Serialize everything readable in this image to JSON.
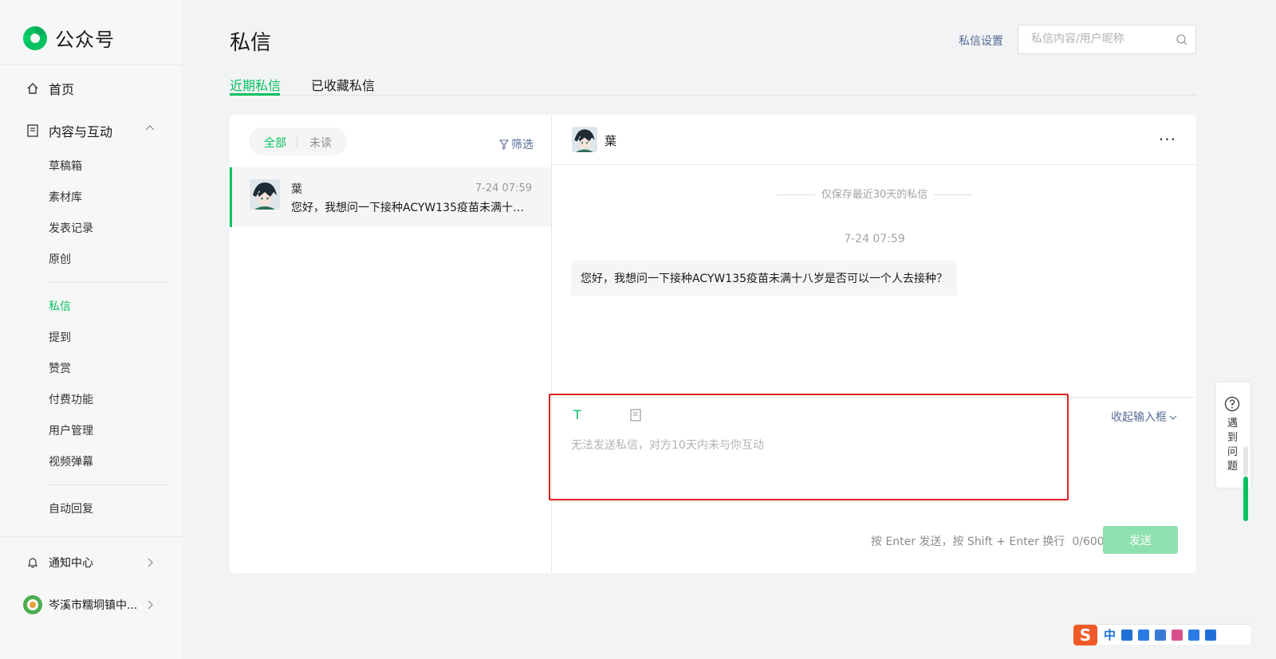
{
  "sidebar": {
    "logo_text": "公众号",
    "home": "首页",
    "content_group": "内容与互动",
    "sub_items": [
      "草稿箱",
      "素材库",
      "发表记录",
      "原创",
      "私信",
      "提到",
      "赞赏",
      "付费功能",
      "用户管理",
      "视频弹幕",
      "自动回复"
    ],
    "active_item": "私信",
    "notifications": "通知中心",
    "account_name": "岑溪市糯垌镇中..."
  },
  "header": {
    "title": "私信",
    "settings_link": "私信设置",
    "search_placeholder": "私信内容/用户昵称"
  },
  "tabs": [
    {
      "label": "近期私信",
      "active": true
    },
    {
      "label": "已收藏私信",
      "active": false
    }
  ],
  "list": {
    "segment_all": "全部",
    "segment_unread": "未读",
    "filter_label": "筛选",
    "items": [
      {
        "name": "葉",
        "time": "7-24 07:59",
        "preview": "您好，我想问一下接种ACYW135疫苗未满十八..."
      }
    ]
  },
  "chat": {
    "contact_name": "葉",
    "more_label": "···",
    "notice": "仅保存最近30天的私信",
    "time": "7-24 07:59",
    "message": "您好，我想问一下接种ACYW135疫苗未满十八岁是否可以一个人去接种？",
    "collapse_label": "收起输入框",
    "input_hint": "无法发送私信，对方10天内未与你互动",
    "send_hint": "按 Enter 发送，按 Shift + Enter 换行",
    "char_count": "0/600",
    "send_button": "发送"
  },
  "help": {
    "label": "遇到问题"
  },
  "ime": {
    "logo": "S",
    "mode": "中"
  },
  "colors": {
    "accent": "#07c160",
    "link": "#576b95",
    "highlight_box": "#e02020"
  }
}
